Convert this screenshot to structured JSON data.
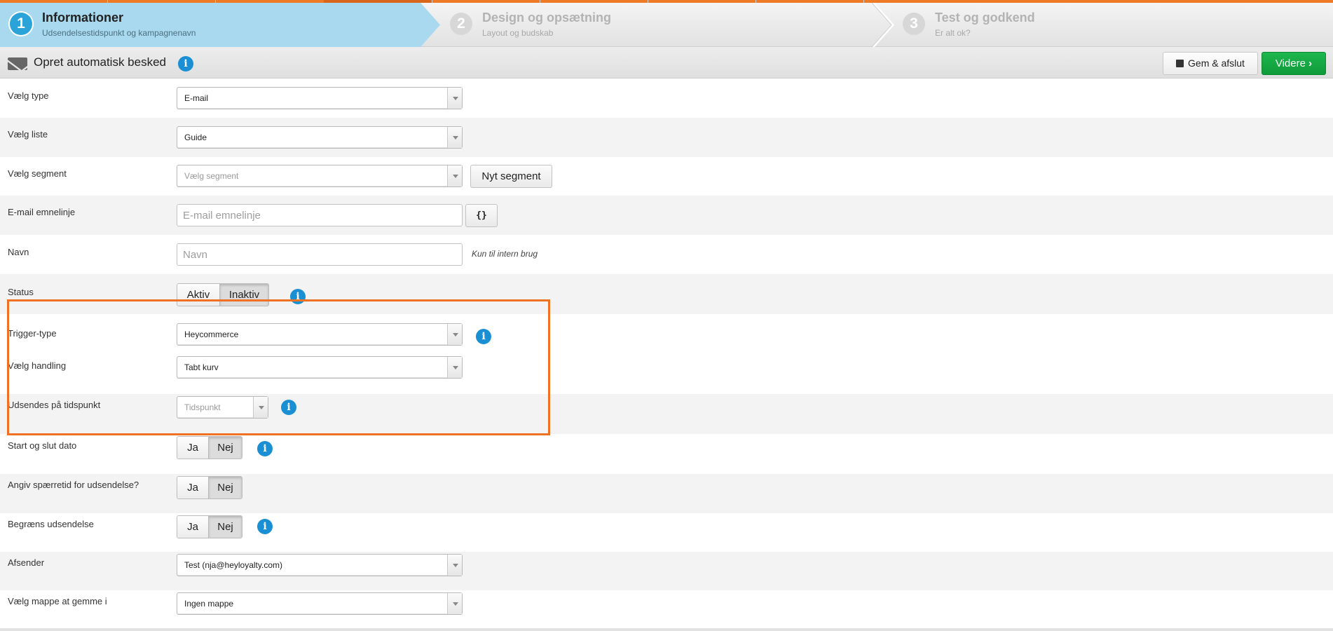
{
  "wizard": {
    "steps": [
      {
        "number": "1",
        "title": "Informationer",
        "subtitle": "Udsendelsestidspunkt og kampagnenavn",
        "active": true
      },
      {
        "number": "2",
        "title": "Design og opsætning",
        "subtitle": "Layout og budskab",
        "active": false
      },
      {
        "number": "3",
        "title": "Test og godkend",
        "subtitle": "Er alt ok?",
        "active": false
      }
    ]
  },
  "header": {
    "title": "Opret automatisk besked",
    "icon": "envelope-icon",
    "info_glyph": "i",
    "save_label": "Gem & afslut",
    "next_label": "Videre",
    "next_arrow": "›"
  },
  "colors": {
    "accent": "#ee7a26",
    "active_step_bg": "#a8d9ee",
    "info_blue": "#1b8fd3",
    "next_green": "#14a843"
  },
  "form": {
    "type": {
      "label": "Vælg type",
      "value": "E-mail"
    },
    "list": {
      "label": "Vælg liste",
      "value": "Guide"
    },
    "segment": {
      "label": "Vælg segment",
      "placeholder": "Vælg segment",
      "button": "Nyt segment"
    },
    "subject": {
      "label": "E-mail emnelinje",
      "placeholder": "E-mail emnelinje",
      "button": "{}"
    },
    "name": {
      "label": "Navn",
      "placeholder": "Navn",
      "note": "Kun til intern brug"
    },
    "status": {
      "label": "Status",
      "options": [
        "Aktiv",
        "Inaktiv"
      ],
      "selected": "Inaktiv"
    },
    "trigger_type": {
      "label": "Trigger-type",
      "value": "Heycommerce"
    },
    "action": {
      "label": "Vælg handling",
      "value": "Tabt kurv"
    },
    "send_time": {
      "label": "Udsendes på tidspunkt",
      "placeholder": "Tidspunkt"
    },
    "start_end": {
      "label": "Start og slut dato",
      "options": [
        "Ja",
        "Nej"
      ],
      "selected": "Nej"
    },
    "blackout": {
      "label": "Angiv spærretid for udsendelse?",
      "options": [
        "Ja",
        "Nej"
      ],
      "selected": "Nej"
    },
    "limit": {
      "label": "Begræns udsendelse",
      "options": [
        "Ja",
        "Nej"
      ],
      "selected": "Nej"
    },
    "sender": {
      "label": "Afsender",
      "value": "Test (nja@heyloyalty.com)"
    },
    "folder": {
      "label": "Vælg mappe at gemme i",
      "value": "Ingen mappe"
    }
  }
}
